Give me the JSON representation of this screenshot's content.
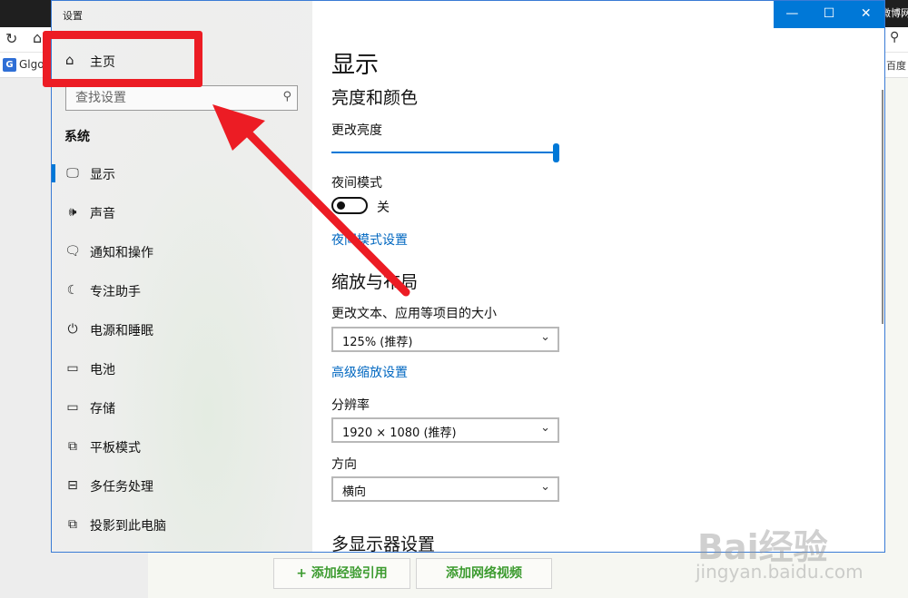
{
  "background": {
    "site_text": "微博网",
    "bookmark_left": "Glgoo",
    "bookmark_right": "百度",
    "buttons": [
      "+ 添加经验引用",
      "添加网络视频"
    ]
  },
  "window": {
    "title": "设置",
    "controls": {
      "minimize": "—",
      "maximize": "☐",
      "close": "✕"
    }
  },
  "sidebar": {
    "home_label": "主页",
    "search_placeholder": "查找设置",
    "section": "系统",
    "items": [
      {
        "label": "显示",
        "icon": "monitor-icon",
        "glyph": "🖵"
      },
      {
        "label": "声音",
        "icon": "speaker-icon",
        "glyph": "🕪"
      },
      {
        "label": "通知和操作",
        "icon": "notification-icon",
        "glyph": "🗨"
      },
      {
        "label": "专注助手",
        "icon": "moon-icon",
        "glyph": "☾"
      },
      {
        "label": "电源和睡眠",
        "icon": "power-icon",
        "glyph": "⏻"
      },
      {
        "label": "电池",
        "icon": "battery-icon",
        "glyph": "▭"
      },
      {
        "label": "存储",
        "icon": "storage-icon",
        "glyph": "▭"
      },
      {
        "label": "平板模式",
        "icon": "tablet-icon",
        "glyph": "⧉"
      },
      {
        "label": "多任务处理",
        "icon": "multitask-icon",
        "glyph": "⊟"
      },
      {
        "label": "投影到此电脑",
        "icon": "projection-icon",
        "glyph": "⧉"
      }
    ]
  },
  "content": {
    "title": "显示",
    "brightness_section": "亮度和颜色",
    "brightness_label": "更改亮度",
    "brightness_level": 1.0,
    "night_mode_label": "夜间模式",
    "night_mode_state": "关",
    "night_mode_link": "夜间模式设置",
    "scale_section": "缩放与布局",
    "scale_label": "更改文本、应用等项目的大小",
    "scale_value": "125% (推荐)",
    "advanced_scale_link": "高级缩放设置",
    "resolution_label": "分辨率",
    "resolution_value": "1920 × 1080 (推荐)",
    "orientation_label": "方向",
    "orientation_value": "横向",
    "multi_display_section": "多显示器设置"
  },
  "watermark": {
    "main": "Bai经验",
    "sub": "jingyan.baidu.com"
  },
  "colors": {
    "accent": "#0078d7",
    "annotation": "#ec1c24",
    "link": "#0067c0"
  }
}
